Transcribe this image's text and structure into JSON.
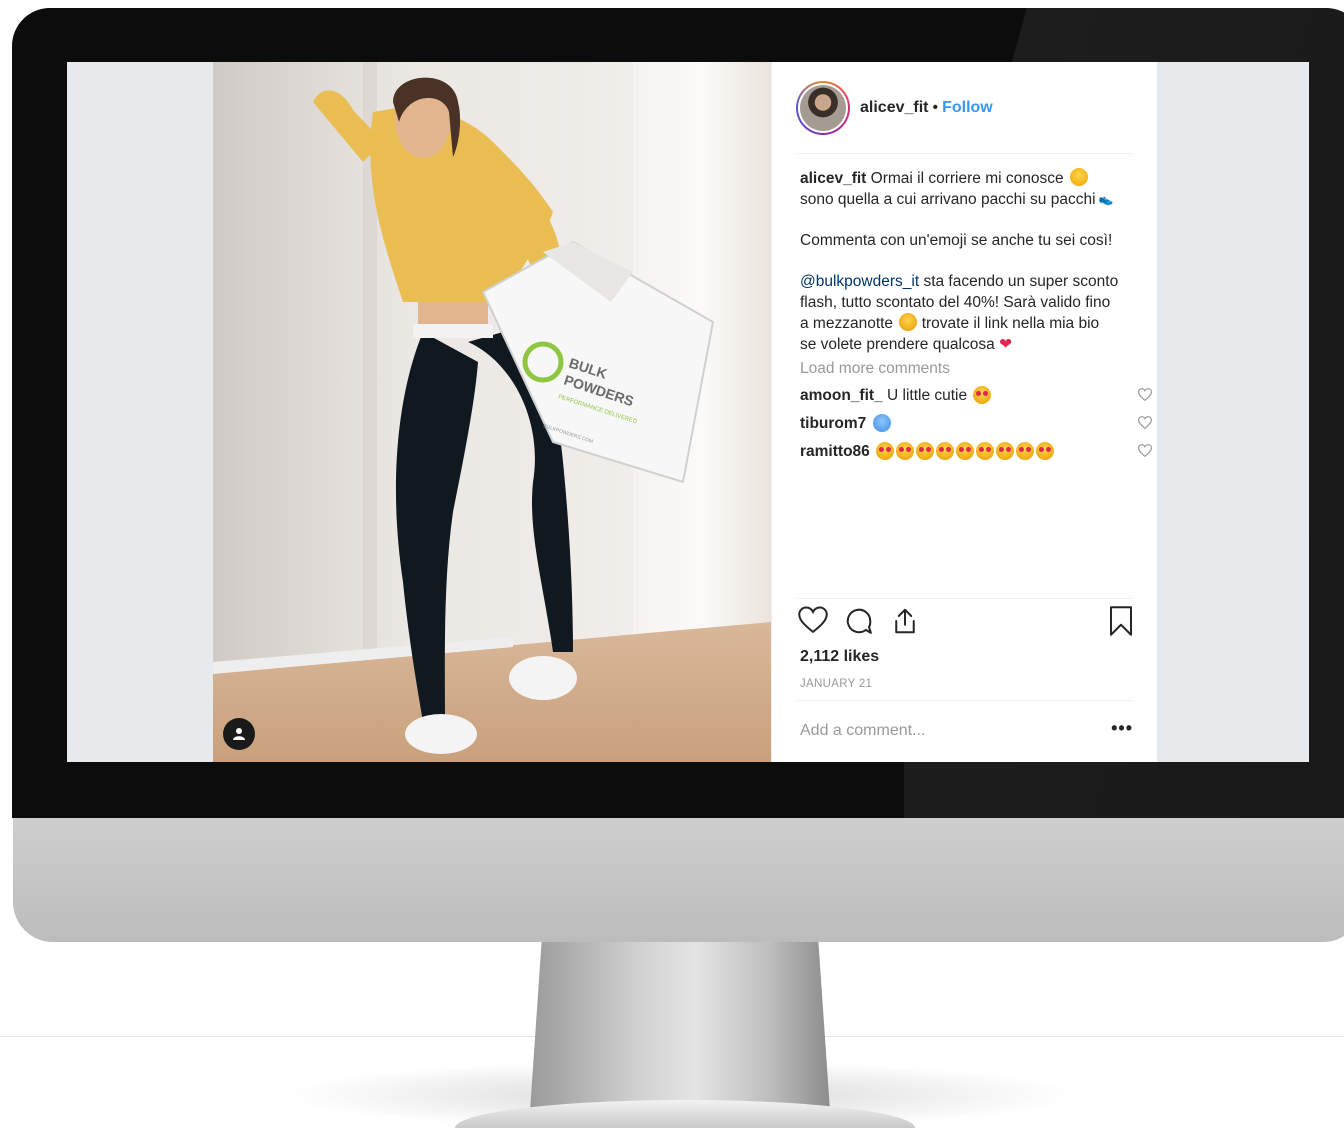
{
  "post": {
    "username": "alicev_fit",
    "separator": "•",
    "follow_label": "Follow",
    "caption_lines": [
      "Ormai il corriere mi conosce",
      "sono quella a cui arrivano pacchi su pacchi"
    ],
    "paragraph2": "Commenta con un'emoji se anche tu sei così!",
    "mention": "@bulkpowders_it",
    "paragraph3_rest": " sta facendo un super sconto",
    "paragraph3_lines": [
      "flash, tutto scontato del 40%! Sarà valido fino",
      "a mezzanotte",
      "trovate il link nella mia bio",
      "se volete prendere qualcosa"
    ],
    "load_more_label": "Load more comments",
    "comments": [
      {
        "user": "amoon_fit_",
        "text": "U little cutie"
      },
      {
        "user": "tiburom7",
        "text": ""
      },
      {
        "user": "ramitto86",
        "text": ""
      }
    ],
    "likes": "2,112 likes",
    "date": "JANUARY 21",
    "add_comment_placeholder": "Add a comment...",
    "more_label": "•••"
  },
  "photo": {
    "box_text_1": "BULK",
    "box_text_2": "POWDERS",
    "box_text_3": "PERFORMANCE DELIVERED",
    "box_text_4": "BULKPOWDERS.COM"
  },
  "icons": {
    "like": "heart-icon",
    "comment": "comment-icon",
    "share": "share-icon",
    "save": "bookmark-icon",
    "user_tag": "user-tag-icon"
  },
  "colors": {
    "accent": "#3897f0",
    "text": "#262626",
    "muted": "#999999",
    "mention": "#003569"
  }
}
